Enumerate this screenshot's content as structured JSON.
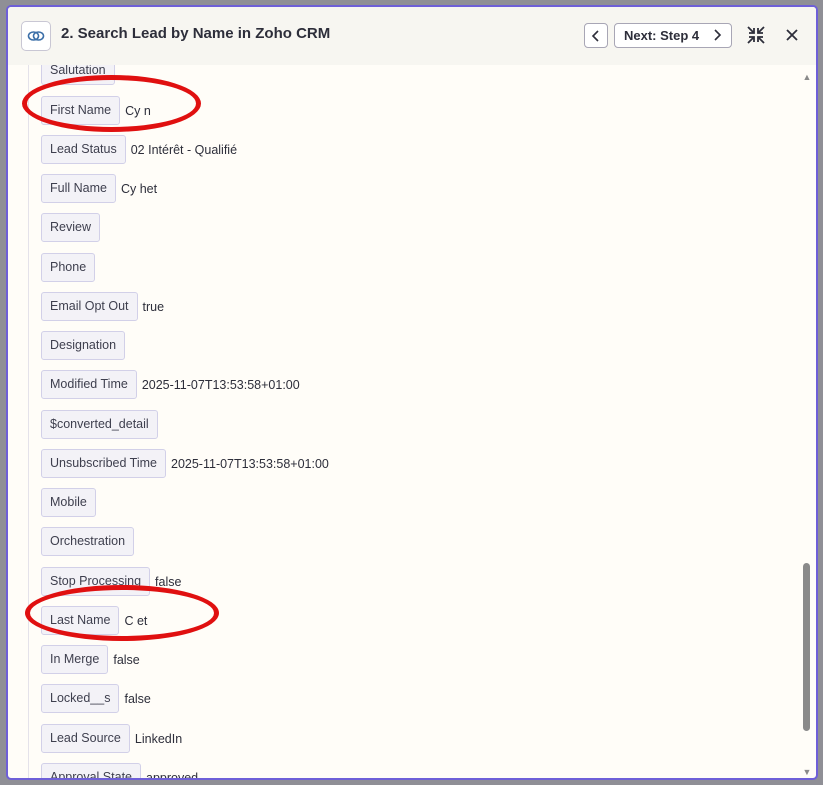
{
  "header": {
    "title": "2. Search Lead by Name in Zoho CRM",
    "next_label": "Next: Step 4",
    "app_icon": "zoho-crm-icon",
    "prev_icon": "chevron-left-icon",
    "next_icon": "chevron-right-icon",
    "collapse_icon": "collapse-icon",
    "close_icon": "close-icon"
  },
  "fields": [
    {
      "label": "Salutation",
      "value": ""
    },
    {
      "label": "First Name",
      "value": "Cy      n"
    },
    {
      "label": "Lead Status",
      "value": "02 Intérêt - Qualifié"
    },
    {
      "label": "Full Name",
      "value": "Cy         het"
    },
    {
      "label": "Review",
      "value": ""
    },
    {
      "label": "Phone",
      "value": ""
    },
    {
      "label": "Email Opt Out",
      "value": "true"
    },
    {
      "label": "Designation",
      "value": ""
    },
    {
      "label": "Modified Time",
      "value": "2025-11-07T13:53:58+01:00"
    },
    {
      "label": "$converted_detail",
      "value": ""
    },
    {
      "label": "Unsubscribed Time",
      "value": "2025-11-07T13:53:58+01:00"
    },
    {
      "label": "Mobile",
      "value": ""
    },
    {
      "label": "Orchestration",
      "value": ""
    },
    {
      "label": "Stop Processing",
      "value": "false"
    },
    {
      "label": "Last Name",
      "value": "C         et"
    },
    {
      "label": "In Merge",
      "value": "false"
    },
    {
      "label": "Locked__s",
      "value": "false"
    },
    {
      "label": "Lead Source",
      "value": "LinkedIn"
    },
    {
      "label": "Approval State",
      "value": "approved"
    }
  ],
  "colors": {
    "accent_border": "#6e5fd8",
    "annotation": "#e01010",
    "chip_bg": "#f3f2f7",
    "panel_bg": "#fffdf8"
  }
}
